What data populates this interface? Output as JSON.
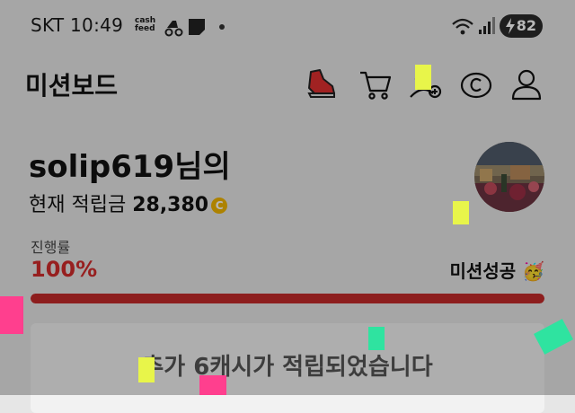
{
  "status_bar": {
    "carrier_time": "SKT 10:49",
    "cashfeed_line1": "cash",
    "cashfeed_line2": "feed",
    "battery": "82"
  },
  "header": {
    "title": "미션보드"
  },
  "user": {
    "greeting": "solip619님의",
    "points_label": "현재 적립금",
    "points_value": "28,380",
    "coin_symbol": "C"
  },
  "progress": {
    "label": "진행률",
    "value_text": "100%",
    "fraction": 1.0,
    "status_text": "미션성공 🥳"
  },
  "message": {
    "text": "추가 6캐시가 적립되었습니다"
  },
  "colors": {
    "accent_red": "#c42a2a",
    "coin": "#f0b400",
    "confetti_yellow": "#e8f54a",
    "confetti_pink": "#ff3f8e",
    "confetti_green": "#2fe3a0"
  }
}
